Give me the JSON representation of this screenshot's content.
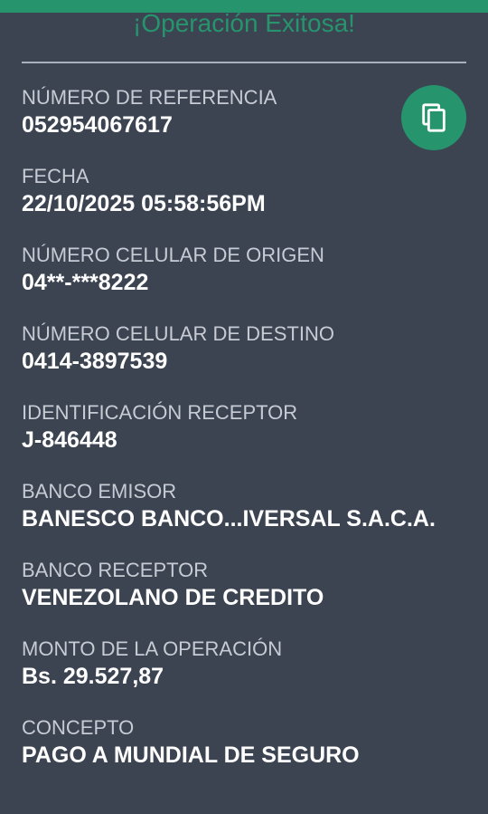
{
  "header": {
    "title": "¡Operación Exitosa!"
  },
  "colors": {
    "accent": "#26946c",
    "background": "#3c4452",
    "label": "#c7ccd4",
    "value": "#ffffff"
  },
  "copy_button": {
    "icon": "copy-icon"
  },
  "fields": [
    {
      "label": "NÚMERO DE REFERENCIA",
      "value": "052954067617"
    },
    {
      "label": "FECHA",
      "value": "22/10/2025 05:58:56PM"
    },
    {
      "label": "NÚMERO CELULAR DE ORIGEN",
      "value": "04**-***8222"
    },
    {
      "label": "NÚMERO CELULAR DE DESTINO",
      "value": "0414-3897539"
    },
    {
      "label": "IDENTIFICACIÓN RECEPTOR",
      "value": "J-846448"
    },
    {
      "label": "BANCO EMISOR",
      "value": "BANESCO BANCO...IVERSAL S.A.C.A."
    },
    {
      "label": "BANCO RECEPTOR",
      "value": "VENEZOLANO DE CREDITO"
    },
    {
      "label": "MONTO DE LA OPERACIÓN",
      "value": "Bs. 29.527,87"
    },
    {
      "label": "CONCEPTO",
      "value": "PAGO A MUNDIAL DE SEGURO"
    }
  ]
}
